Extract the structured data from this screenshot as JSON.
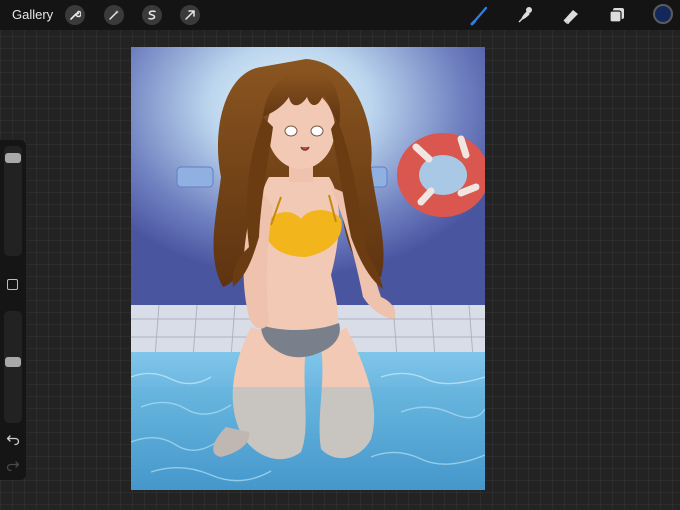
{
  "toolbar": {
    "gallery_label": "Gallery",
    "left_tools": [
      {
        "icon": "wrench-icon",
        "name": "actions"
      },
      {
        "icon": "magic-wand-icon",
        "name": "adjustments"
      },
      {
        "icon": "selection-icon",
        "name": "selection"
      },
      {
        "icon": "transform-arrow-icon",
        "name": "transform"
      }
    ],
    "right_tools": [
      {
        "icon": "brush-icon",
        "name": "brush",
        "active": true
      },
      {
        "icon": "smudge-icon",
        "name": "smudge"
      },
      {
        "icon": "eraser-icon",
        "name": "eraser"
      },
      {
        "icon": "layers-icon",
        "name": "layers"
      }
    ],
    "current_color": "#13285a",
    "accent_color": "#2f7de1"
  },
  "sidebar": {
    "brush_size_level": 0.95,
    "opacity_level": 0.55
  },
  "canvas": {
    "artwork": "anime-girl-in-pool",
    "palette": {
      "wall": "#5a6ab0",
      "wall_light": "#c8def0",
      "water": "#5fb6e0",
      "tile": "#d8dce6",
      "hair": "#7a4416",
      "skin": "#f2c9b4",
      "bikini_top": "#f2b51c",
      "bikini_bottom": "#7a7f8c",
      "float": "#d9574e"
    }
  }
}
